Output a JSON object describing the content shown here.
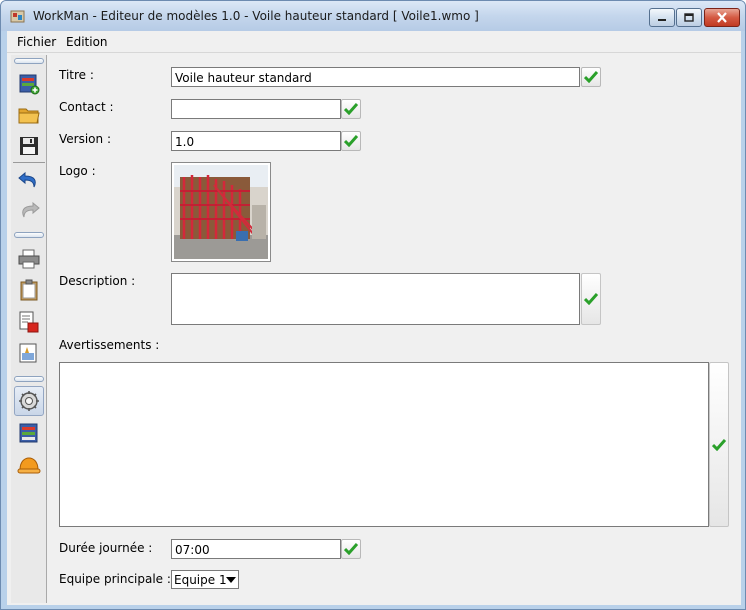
{
  "window": {
    "title": "WorkMan - Editeur de modèles 1.0  - Voile hauteur standard [ Voile1.wmo ]"
  },
  "menu": {
    "items": [
      {
        "label": "Fichier"
      },
      {
        "label": "Edition"
      }
    ]
  },
  "toolbar": {
    "buttons": [
      {
        "icon": "new-model-icon"
      },
      {
        "icon": "open-folder-icon"
      },
      {
        "icon": "save-disk-icon"
      },
      {
        "icon": "undo-icon"
      },
      {
        "icon": "redo-icon",
        "disabled": true
      },
      {
        "icon": "print-icon"
      },
      {
        "icon": "clipboard-icon"
      },
      {
        "icon": "pdf-export-icon"
      },
      {
        "icon": "image-export-icon"
      },
      {
        "icon": "settings-gear-icon",
        "active": true
      },
      {
        "icon": "model-list-icon"
      },
      {
        "icon": "hard-hat-icon"
      }
    ]
  },
  "form": {
    "titre": {
      "label": "Titre :",
      "value": "Voile hauteur standard"
    },
    "contact": {
      "label": "Contact :",
      "value": ""
    },
    "version": {
      "label": "Version :",
      "value": "1.0"
    },
    "logo": {
      "label": "Logo :"
    },
    "description": {
      "label": "Description :",
      "value": ""
    },
    "avertissements": {
      "label": "Avertissements :",
      "value": ""
    },
    "duree": {
      "label": "Durée journée :",
      "value": "07:00"
    },
    "equipe": {
      "label": "Equipe principale :",
      "value": "Equipe 1"
    }
  },
  "colors": {
    "check_green": "#2aa02a",
    "title_gradient_top": "#dce8f6",
    "close_red": "#c13a22"
  }
}
